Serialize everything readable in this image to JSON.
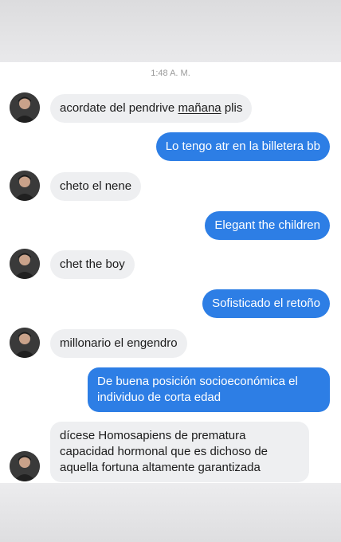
{
  "timestamp": "1:48 A. M.",
  "messages": [
    {
      "side": "in",
      "text": "acordate del pendrive mañana plis"
    },
    {
      "side": "out",
      "text": "Lo tengo atr en la billetera bb"
    },
    {
      "side": "in",
      "text": "cheto el nene"
    },
    {
      "side": "out",
      "text": "Elegant the children"
    },
    {
      "side": "in",
      "text": "chet the boy"
    },
    {
      "side": "out",
      "text": "Sofisticado el retoño"
    },
    {
      "side": "in",
      "text": "millonario el engendro"
    },
    {
      "side": "out",
      "text": "De buena posición socioeconómica el individuo de corta edad"
    },
    {
      "side": "in",
      "text": "dícese Homosapiens de prematura capacidad hormonal que es dichoso de aquella fortuna altamente garantizada"
    }
  ],
  "msg0": {
    "before": "acordate del pendrive ",
    "underlined": "mañana",
    "after": " plis"
  },
  "colors": {
    "outgoing": "#2d7ee5",
    "incoming": "#eeeff1",
    "background": "#ffffff"
  }
}
